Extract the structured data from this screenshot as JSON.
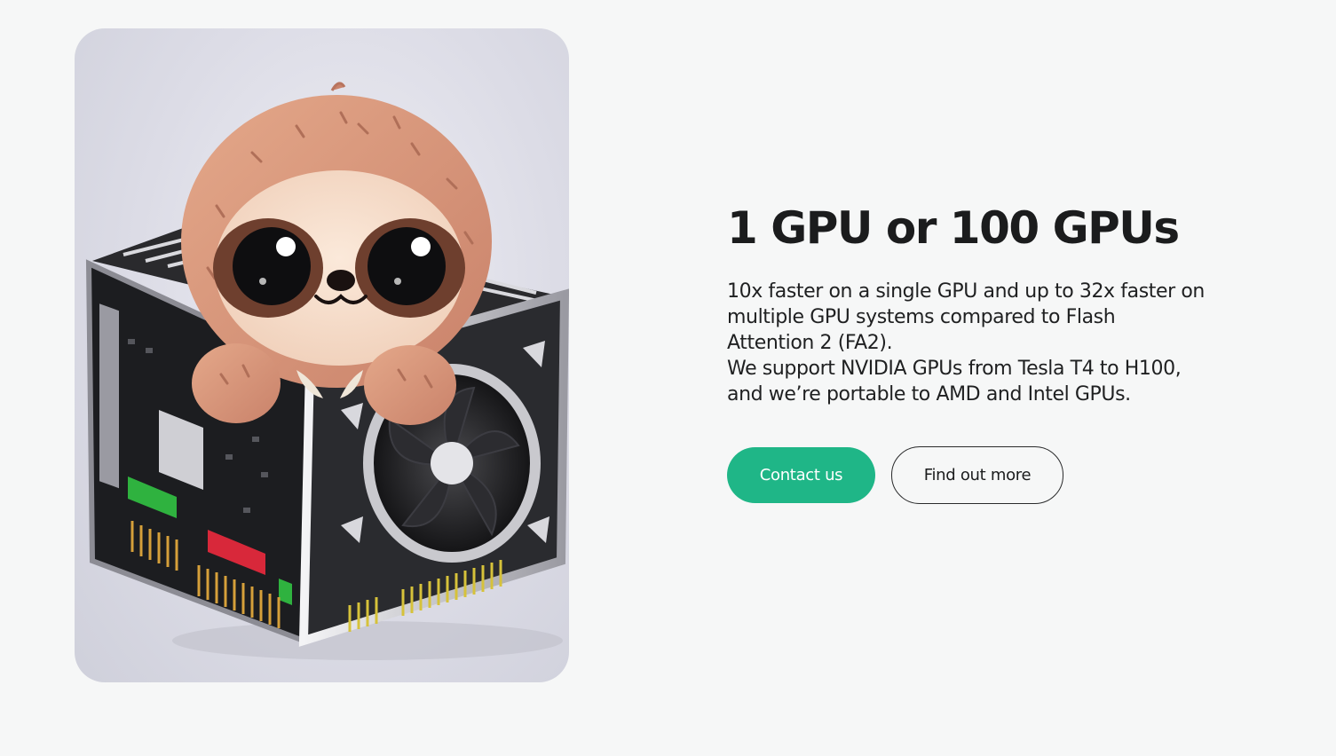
{
  "hero": {
    "title": "1 GPU or 100 GPUs",
    "description_lines": [
      "10x faster on a single GPU and up to 32x faster on",
      "multiple GPU systems compared to Flash",
      "Attention 2 (FA2).",
      "We support NVIDIA GPUs from Tesla T4 to H100,",
      "and we’re portable to AMD and Intel GPUs."
    ],
    "image_subject": "sloth-mascot-on-gpu"
  },
  "actions": {
    "contact_label": "Contact us",
    "find_out_more_label": "Find out more"
  },
  "colors": {
    "background": "#f6f7f7",
    "primary_button": "#1fb687",
    "text": "#1b1c1d"
  }
}
